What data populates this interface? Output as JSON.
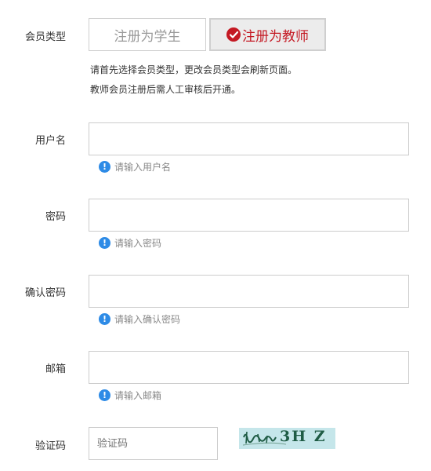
{
  "member_type": {
    "label": "会员类型",
    "student_option": "注册为学生",
    "teacher_option": "注册为教师",
    "selected": "teacher",
    "note_line1": "请首先选择会员类型，更改会员类型会刷新页面。",
    "note_line2": "教师会员注册后需人工审核后开通。"
  },
  "fields": {
    "username": {
      "label": "用户名",
      "value": "",
      "hint": "请输入用户名"
    },
    "password": {
      "label": "密码",
      "value": "",
      "hint": "请输入密码"
    },
    "confirm_password": {
      "label": "确认密码",
      "value": "",
      "hint": "请输入确认密码"
    },
    "email": {
      "label": "邮箱",
      "value": "",
      "hint": "请输入邮箱"
    },
    "captcha": {
      "label": "验证码",
      "placeholder": "验证码",
      "value": "",
      "image_text": "3H Z"
    }
  },
  "colors": {
    "accent": "#c41923",
    "info": "#2e8be6",
    "captcha_bg": "#c5e6ea"
  },
  "icons": {
    "selected": "check-circle-icon",
    "hint": "info-circle-icon"
  }
}
